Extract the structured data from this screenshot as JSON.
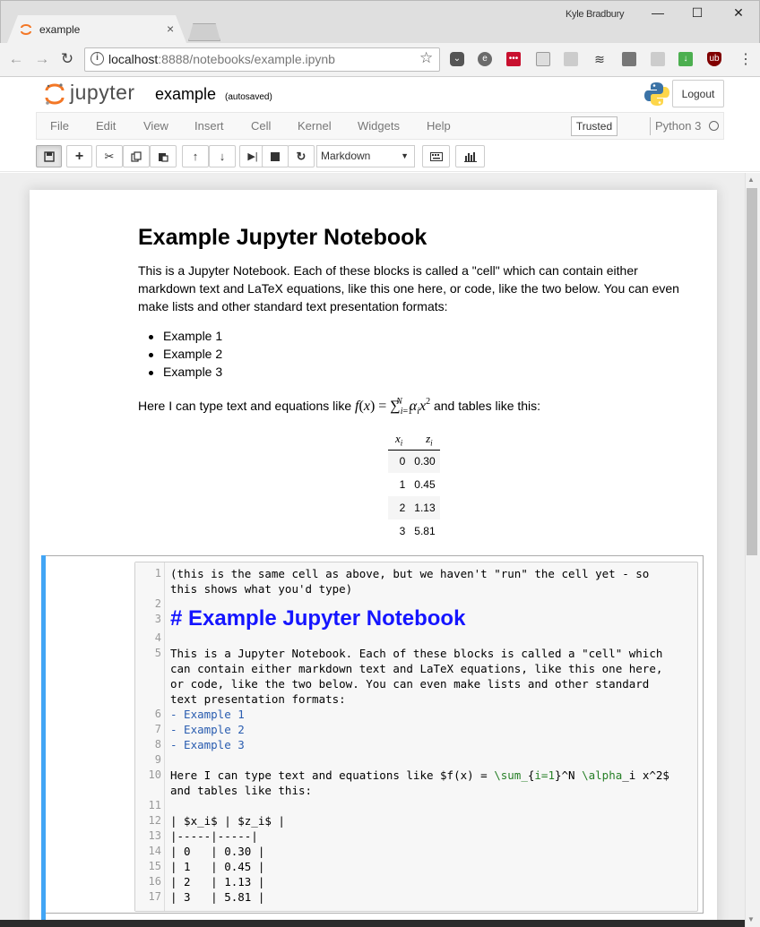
{
  "browser": {
    "tab_title": "example",
    "tab_close": "×",
    "user": "Kyle Bradbury",
    "url_host": "localhost",
    "url_rest": ":8888/notebooks/example.ipynb",
    "window_controls": {
      "minimize": "—",
      "maximize": "☐",
      "close": "✕"
    }
  },
  "jupyter": {
    "logo_text": "jupyter",
    "notebook_name": "example",
    "save_status": "(autosaved)",
    "logout_label": "Logout",
    "menu": [
      "File",
      "Edit",
      "View",
      "Insert",
      "Cell",
      "Kernel",
      "Widgets",
      "Help"
    ],
    "trusted_label": "Trusted",
    "kernel_name": "Python 3",
    "cell_type": "Markdown"
  },
  "markdown": {
    "heading": "Example Jupyter Notebook",
    "intro": "This is a Jupyter Notebook. Each of these blocks is called a \"cell\" which can contain either markdown text and LaTeX equations, like this one here, or code, like the two below. You can even make lists and other standard text presentation formats:",
    "list": [
      "Example 1",
      "Example 2",
      "Example 3"
    ],
    "equation_prefix": "Here I can type text and equations like",
    "equation_suffix": "and tables like this:",
    "table": {
      "headers": [
        "x",
        "z"
      ],
      "rows": [
        [
          "0",
          "0.30"
        ],
        [
          "1",
          "0.45"
        ],
        [
          "2",
          "1.13"
        ],
        [
          "3",
          "5.81"
        ]
      ]
    }
  },
  "code_cell": {
    "line_numbers": [
      "1",
      "2",
      "3",
      "4",
      "5",
      "6",
      "7",
      "8",
      "9",
      "10",
      "11",
      "12",
      "13",
      "14",
      "15",
      "16",
      "17"
    ],
    "l1a": "(this is the same cell as above, but we haven't \"run\" the cell yet - so",
    "l1b": "this shows what you'd type)",
    "l3": "# Example Jupyter Notebook",
    "l5a": "This is a Jupyter Notebook. Each of these blocks is called a \"cell\" which",
    "l5b": "can contain either markdown text and LaTeX equations, like this one here,",
    "l5c": "or code, like the two below. You can even make lists and other standard",
    "l5d": "text presentation formats:",
    "l6": "- Example 1",
    "l7": "- Example 2",
    "l8": "- Example 3",
    "l10b": "and tables like this:",
    "l12": "| $x_i$ | $z_i$ |",
    "l13": "|-----|-----|",
    "l14": "| 0   | 0.30 |",
    "l15": "| 1   | 0.45 |",
    "l16": "| 2   | 1.13 |",
    "l17": "| 3   | 5.81 |"
  },
  "colors": {
    "edit_bar": "#42a5f5",
    "code_heading": "#1515ff",
    "list_code": "#2a5db0"
  }
}
